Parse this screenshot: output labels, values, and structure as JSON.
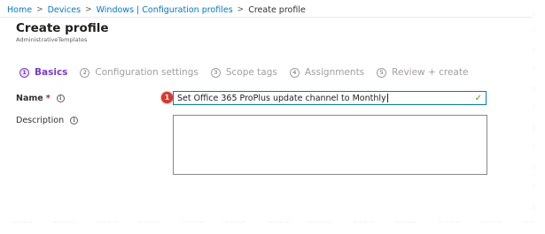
{
  "breadcrumb": {
    "items": [
      "Home",
      "Devices",
      "Windows | Configuration profiles"
    ],
    "current": "Create profile",
    "separator": ">"
  },
  "header": {
    "title": "Create profile",
    "subtitle": "AdministrativeTemplates"
  },
  "steps": [
    {
      "number": "1",
      "label": "Basics",
      "active": true
    },
    {
      "number": "2",
      "label": "Configuration settings",
      "active": false
    },
    {
      "number": "3",
      "label": "Scope tags",
      "active": false
    },
    {
      "number": "4",
      "label": "Assignments",
      "active": false
    },
    {
      "number": "5",
      "label": "Review + create",
      "active": false
    }
  ],
  "form": {
    "name": {
      "label": "Name",
      "required_mark": "*",
      "info_glyph": "i",
      "value": "Set Office 365 ProPlus update channel to Monthly",
      "valid_glyph": "✓"
    },
    "description": {
      "label": "Description",
      "info_glyph": "i",
      "value": ""
    }
  },
  "annotation": {
    "callout_number": "1"
  },
  "colors": {
    "link": "#0078d4",
    "accent": "#773adc",
    "input_focus_border": "#0078d4",
    "valid_check": "#57a300",
    "callout": "#d9372b",
    "required": "#a4262c"
  },
  "icons": {
    "breadcrumb_separator": "chevron-right-icon",
    "info": "info-icon",
    "valid": "checkmark-icon"
  }
}
